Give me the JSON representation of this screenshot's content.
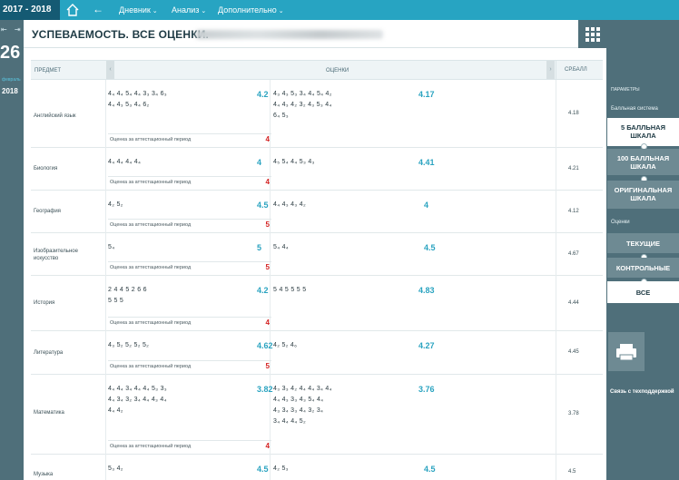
{
  "topbar": {
    "year": "2017 - 2018",
    "menu": [
      {
        "label": "Дневник"
      },
      {
        "label": "Анализ"
      },
      {
        "label": "Дополнительно"
      }
    ]
  },
  "leftstrip": {
    "arrows": "⇤ ⇥",
    "day": "26",
    "month": "февраль",
    "year": "2018"
  },
  "page": {
    "title": "УСПЕВАЕМОСТЬ. ВСЕ ОЦЕНКИ."
  },
  "table": {
    "headers": {
      "subject": "ПРЕДМЕТ",
      "grades": "ОЦЕНКИ",
      "avg": "СР.БАЛЛ"
    },
    "att_label": "Оценка за аттестационный период",
    "rows": [
      {
        "subject": "Английский язык",
        "g1": [
          "4₄ 4₄ 5₄ 4₄ 3₃ 3₄ 6₃",
          "4₄ 4₃ 5₃ 4₄ 6₂"
        ],
        "a1": "4.2",
        "g2": [
          "4₃ 4₃ 5₃ 3₄ 4₄ 5₄ 4₂",
          "4₄ 4₃ 4₂ 3₂ 4₃ 5₃ 4₄",
          "6₄ 5₃"
        ],
        "a2": "4.17",
        "att": "4",
        "final": "4.18"
      },
      {
        "subject": "Биология",
        "g1": [
          "4₄ 4₄ 4₄ 4₄"
        ],
        "a1": "4",
        "g2": [
          "4₅ 5₄ 4₄ 5₃ 4₃"
        ],
        "a2": "4.41",
        "att": "4",
        "final": "4.21"
      },
      {
        "subject": "География",
        "g1": [
          "4₂ 5₂"
        ],
        "a1": "4.5",
        "g2": [
          "4₄ 4₃ 4₃ 4₂"
        ],
        "a2": "4",
        "att": "5",
        "final": "4.12"
      },
      {
        "subject": "Изобразительное искусство",
        "g1": [
          "5₄"
        ],
        "a1": "5",
        "g2": [
          "5₄ 4₄"
        ],
        "a2": "4.5",
        "att": "5",
        "final": "4.67"
      },
      {
        "subject": "История",
        "g1": [
          "2 4 4 5 2 6 6",
          "5 5 5"
        ],
        "a1": "4.2",
        "g2": [
          "5 4 5 5 5 5"
        ],
        "a2": "4.83",
        "att": "4",
        "final": "4.44"
      },
      {
        "subject": "Литература",
        "g1": [
          "4₃ 5₂ 5₂ 5₂ 5₂"
        ],
        "a1": "4.62",
        "g2": [
          "4₂ 5₂ 4₆"
        ],
        "a2": "4.27",
        "att": "5",
        "final": "4.45"
      },
      {
        "subject": "Математика",
        "g1": [
          "4₄ 4₄ 3₄ 4₄ 4₄ 5₃ 3₃",
          "4₄ 3₄ 3₂ 3₄ 4₄ 4₃ 4₄",
          "4₄ 4₂"
        ],
        "a1": "3.82",
        "g2": [
          "4₃ 3₃ 4₂ 4₄ 4₄ 3₄ 4₄",
          "4₄ 4₃ 3₃ 4₃ 5₄ 4₄",
          "4₃ 3₄ 3₃ 4₄ 3₂ 3₄",
          "3₄ 4₄ 4₄ 5₂"
        ],
        "a2": "3.76",
        "att": "4",
        "final": "3.78"
      },
      {
        "subject": "Музыка",
        "g1": [
          "5₃ 4₂"
        ],
        "a1": "4.5",
        "g2": [
          "4₂ 5₃"
        ],
        "a2": "4.5",
        "att": "",
        "final": "4.5"
      }
    ]
  },
  "rightpanel": {
    "params_label": "ПАРАМЕТРЫ",
    "system_label": "Балльная система",
    "scale_options": [
      "5 БАЛЛЬНАЯ ШКАЛА",
      "100 БАЛЛЬНАЯ ШКАЛА",
      "ОРИГИНАЛЬНАЯ ШКАЛА"
    ],
    "grades_label": "Оценки",
    "grade_options": [
      "ТЕКУЩИЕ",
      "КОНТРОЛЬНЫЕ",
      "ВСЕ"
    ],
    "support": "Связь с техподдержкой"
  },
  "colors": {
    "accent": "#27a4c2",
    "dark": "#155a73",
    "panel": "#4f6f7a",
    "red": "#d42222"
  }
}
